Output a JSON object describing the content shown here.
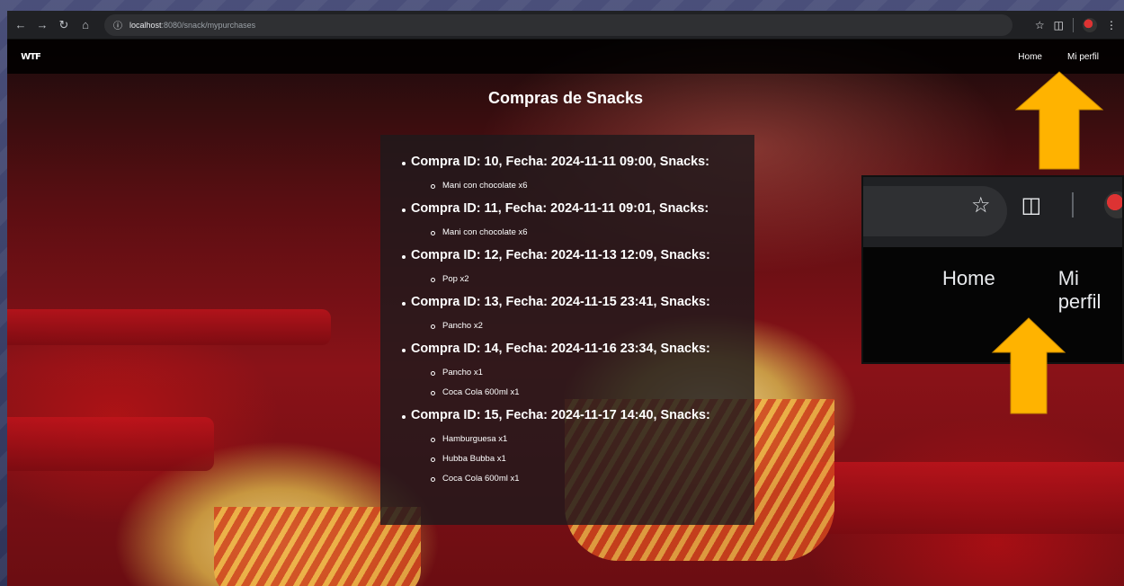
{
  "browser": {
    "url_host": "localhost",
    "url_path": ":8080/snack/mypurchases",
    "icons": [
      "back-icon",
      "forward-icon",
      "reload-icon",
      "home-icon",
      "site-info-icon",
      "bookmark-star-icon",
      "extensions-icon",
      "profile-avatar"
    ]
  },
  "site": {
    "logo": "WTF",
    "nav": [
      "Home",
      "Mi perfil"
    ]
  },
  "page_title": "Compras de Snacks",
  "purchases": [
    {
      "header": "Compra ID: 10, Fecha: 2024-11-11 09:00, Snacks:",
      "snacks": [
        "Mani con chocolate x6"
      ]
    },
    {
      "header": "Compra ID: 11, Fecha: 2024-11-11 09:01, Snacks:",
      "snacks": [
        "Mani con chocolate x6"
      ]
    },
    {
      "header": "Compra ID: 12, Fecha: 2024-11-13 12:09, Snacks:",
      "snacks": [
        "Pop x2"
      ]
    },
    {
      "header": "Compra ID: 13, Fecha: 2024-11-15 23:41, Snacks:",
      "snacks": [
        "Pancho x2"
      ]
    },
    {
      "header": "Compra ID: 14, Fecha: 2024-11-16 23:34, Snacks:",
      "snacks": [
        "Pancho x1",
        "Coca Cola 600ml x1"
      ]
    },
    {
      "header": "Compra ID: 15, Fecha: 2024-11-17 14:40, Snacks:",
      "snacks": [
        "Hamburguesa x1",
        "Hubba Bubba x1",
        "Coca Cola 600ml x1"
      ]
    }
  ],
  "callout": {
    "nav": [
      "Home",
      "Mi perfil"
    ]
  },
  "colors": {
    "arrow": "#ffb300",
    "chrome": "#202124"
  }
}
